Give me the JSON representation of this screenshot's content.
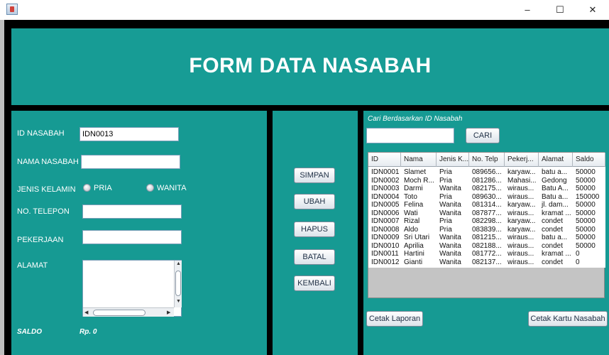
{
  "window": {
    "minimize": "–",
    "maximize": "☐",
    "close": "✕"
  },
  "header": {
    "title": "FORM DATA NASABAH"
  },
  "form": {
    "id_label": "ID NASABAH",
    "id_value": "IDN0013",
    "nama_label": "NAMA NASABAH",
    "nama_value": "",
    "jk_label": "JENIS KELAMIN",
    "radio_pria": "PRIA",
    "radio_wanita": "WANITA",
    "telepon_label": "NO. TELEPON",
    "telepon_value": "",
    "pekerjaan_label": "PEKERJAAN",
    "pekerjaan_value": "",
    "alamat_label": "ALAMAT",
    "alamat_value": "",
    "saldo_label": "SALDO",
    "saldo_value": "Rp. 0"
  },
  "actions": {
    "simpan": "SIMPAN",
    "ubah": "UBAH",
    "hapus": "HAPUS",
    "batal": "BATAL",
    "kembali": "KEMBALI"
  },
  "search": {
    "caption": "Cari Berdasarkan ID Nasabah",
    "value": "",
    "button": "CARI"
  },
  "table": {
    "columns": [
      "ID",
      "Nama",
      "Jenis K...",
      "No. Telp",
      "Pekerj...",
      "Alamat",
      "Saldo"
    ],
    "rows": [
      [
        "IDN0001",
        "Slamet",
        "Pria",
        "089656...",
        "karyaw...",
        "batu a...",
        "50000"
      ],
      [
        "IDN0002",
        "Moch R...",
        "Pria",
        "081286...",
        "Mahasi...",
        "Gedong",
        "50000"
      ],
      [
        "IDN0003",
        "Darmi",
        "Wanita",
        "082175...",
        "wiraus...",
        "Batu A...",
        "50000"
      ],
      [
        "IDN0004",
        "Toto",
        "Pria",
        "089630...",
        "wiraus...",
        "Batu a...",
        "150000"
      ],
      [
        "IDN0005",
        "Felina",
        "Wanita",
        "081314...",
        "karyaw...",
        "jl. dam...",
        "50000"
      ],
      [
        "IDN0006",
        "Wati",
        "Wanita",
        "087877...",
        "wiraus...",
        "kramat ...",
        "50000"
      ],
      [
        "IDN0007",
        "Rizal",
        "Pria",
        "082298...",
        "karyaw...",
        "condet",
        "50000"
      ],
      [
        "IDN0008",
        "Aldo",
        "Pria",
        "083839...",
        "karyaw...",
        "condet",
        "50000"
      ],
      [
        "IDN0009",
        "Sri Utari",
        "Wanita",
        "081215...",
        "wiraus...",
        "batu a...",
        "50000"
      ],
      [
        "IDN0010",
        "Aprilia",
        "Wanita",
        "082188...",
        "wiraus...",
        "condet",
        "50000"
      ],
      [
        "IDN0011",
        "Hartini",
        "Wanita",
        "081772...",
        "wiraus...",
        "kramat ...",
        "0"
      ],
      [
        "IDN0012",
        "Gianti",
        "Wanita",
        "082137...",
        "wiraus...",
        "condet",
        "0"
      ]
    ]
  },
  "reports": {
    "cetak_laporan": "Cetak Laporan",
    "cetak_kartu": "Cetak Kartu Nasabah"
  }
}
